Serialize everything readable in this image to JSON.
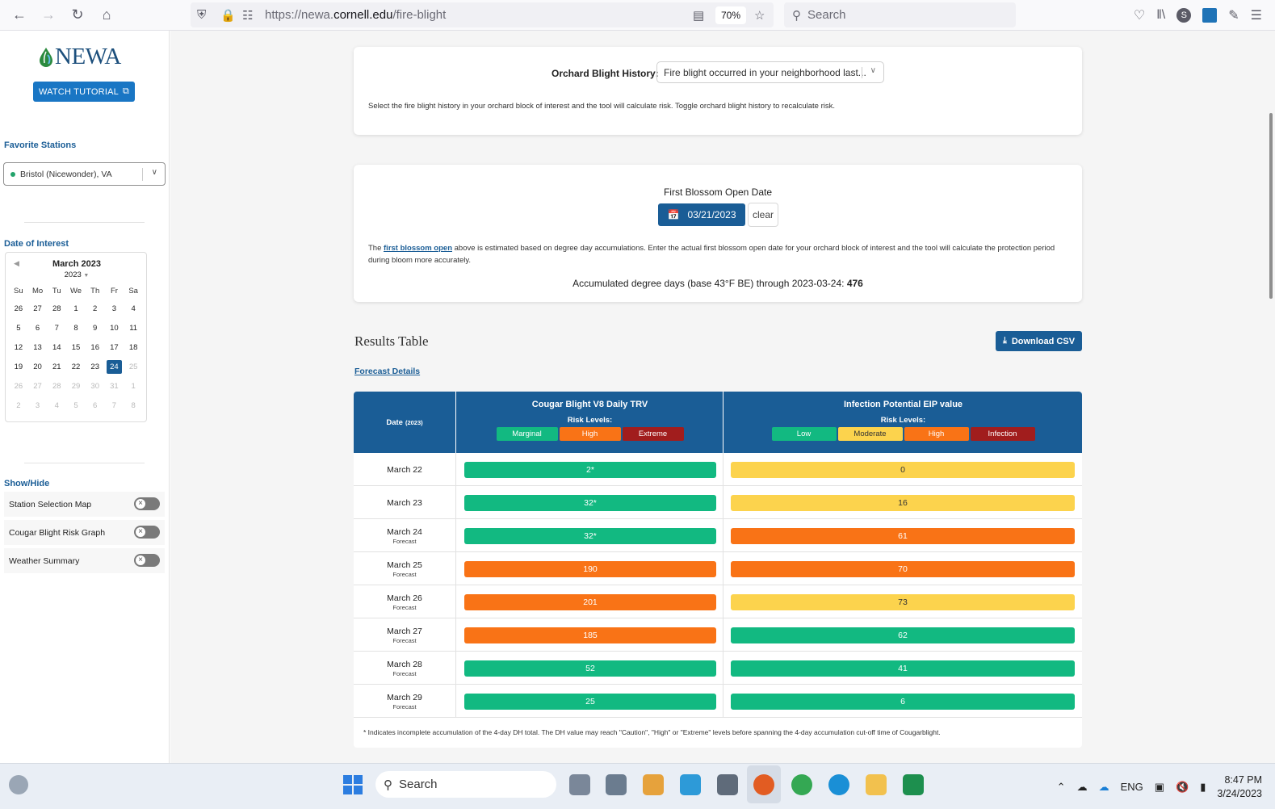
{
  "browser": {
    "url_prefix": "https://newa.",
    "url_host": "cornell.edu",
    "url_path": "/fire-blight",
    "zoom": "70%",
    "search_placeholder": "Search",
    "profile_initial": "S"
  },
  "sidebar": {
    "logo_text": "NEWA",
    "tutorial_label": "WATCH TUTORIAL",
    "favorite_stations_heading": "Favorite Stations",
    "station_name": "Bristol (Nicewonder),",
    "station_state": "VA",
    "date_of_interest_heading": "Date of Interest",
    "calendar": {
      "month_label": "March 2023",
      "year_label": "2023",
      "weekdays": [
        "Su",
        "Mo",
        "Tu",
        "We",
        "Th",
        "Fr",
        "Sa"
      ],
      "weeks": [
        [
          {
            "d": "26",
            "m": false
          },
          {
            "d": "27",
            "m": false
          },
          {
            "d": "28",
            "m": false
          },
          {
            "d": "1",
            "m": false
          },
          {
            "d": "2",
            "m": false
          },
          {
            "d": "3",
            "m": false
          },
          {
            "d": "4",
            "m": false
          }
        ],
        [
          {
            "d": "5",
            "m": false
          },
          {
            "d": "6",
            "m": false
          },
          {
            "d": "7",
            "m": false
          },
          {
            "d": "8",
            "m": false
          },
          {
            "d": "9",
            "m": false
          },
          {
            "d": "10",
            "m": false
          },
          {
            "d": "11",
            "m": false
          }
        ],
        [
          {
            "d": "12",
            "m": false
          },
          {
            "d": "13",
            "m": false
          },
          {
            "d": "14",
            "m": false
          },
          {
            "d": "15",
            "m": false
          },
          {
            "d": "16",
            "m": false
          },
          {
            "d": "17",
            "m": false
          },
          {
            "d": "18",
            "m": false
          }
        ],
        [
          {
            "d": "19",
            "m": false
          },
          {
            "d": "20",
            "m": false
          },
          {
            "d": "21",
            "m": false
          },
          {
            "d": "22",
            "m": false
          },
          {
            "d": "23",
            "m": false
          },
          {
            "d": "24",
            "m": false,
            "sel": true
          },
          {
            "d": "25",
            "m": true
          }
        ],
        [
          {
            "d": "26",
            "m": true
          },
          {
            "d": "27",
            "m": true
          },
          {
            "d": "28",
            "m": true
          },
          {
            "d": "29",
            "m": true
          },
          {
            "d": "30",
            "m": true
          },
          {
            "d": "31",
            "m": true
          },
          {
            "d": "1",
            "m": true
          }
        ],
        [
          {
            "d": "2",
            "m": true
          },
          {
            "d": "3",
            "m": true
          },
          {
            "d": "4",
            "m": true
          },
          {
            "d": "5",
            "m": true
          },
          {
            "d": "6",
            "m": true
          },
          {
            "d": "7",
            "m": true
          },
          {
            "d": "8",
            "m": true
          }
        ]
      ]
    },
    "show_hide_heading": "Show/Hide",
    "toggles": [
      {
        "label": "Station Selection Map",
        "on": false
      },
      {
        "label": "Cougar Blight Risk Graph",
        "on": false
      },
      {
        "label": "Weather Summary",
        "on": false
      }
    ]
  },
  "history": {
    "label": "Orchard Blight History:",
    "selected": "Fire blight occurred in your neighborhood last...",
    "description": "Select the fire blight history in your orchard block of interest and the tool will calculate risk. Toggle orchard blight history to recalculate risk."
  },
  "blossom": {
    "title": "First Blossom Open Date",
    "date": "03/21/2023",
    "clear_label": "clear",
    "desc_before": "The",
    "desc_link": "first blossom open",
    "desc_after": "above is estimated based on degree day accumulations. Enter the actual first blossom open date for your orchard block of interest and the tool will calculate the protection period during bloom more accurately.",
    "accum_text": "Accumulated degree days (base 43°F BE) through 2023-03-24:",
    "accum_value": "476"
  },
  "results": {
    "title": "Results Table",
    "csv_label": "Download CSV",
    "forecast_link": "Forecast Details",
    "date_header": "Date",
    "date_year": "(2023)",
    "cougar_header": "Cougar Blight V8 Daily TRV",
    "eip_header": "Infection Potential EIP value",
    "risk_levels_label": "Risk Levels:",
    "cougar_levels": [
      {
        "label": "Marginal",
        "bg": "#12b981",
        "fg": "#ffffff",
        "w": 76
      },
      {
        "label": "High",
        "bg": "#f97316",
        "fg": "#ffffff",
        "w": 76
      },
      {
        "label": "Extreme",
        "bg": "#a11d1d",
        "fg": "#ffffff",
        "w": 76
      }
    ],
    "eip_levels": [
      {
        "label": "Low",
        "bg": "#12b981",
        "fg": "#ffffff",
        "w": 80
      },
      {
        "label": "Moderate",
        "bg": "#fcd34d",
        "fg": "#333333",
        "w": 80
      },
      {
        "label": "High",
        "bg": "#f97316",
        "fg": "#ffffff",
        "w": 80
      },
      {
        "label": "Infection",
        "bg": "#a11d1d",
        "fg": "#ffffff",
        "w": 80
      }
    ],
    "rows": [
      {
        "date": "March 22",
        "forecast": "",
        "trv": "2*",
        "trv_color": "#12b981",
        "trv_fg": "#ffffff",
        "eip": "0",
        "eip_color": "#fcd34d",
        "eip_fg": "#333333"
      },
      {
        "date": "March 23",
        "forecast": "",
        "trv": "32*",
        "trv_color": "#12b981",
        "trv_fg": "#ffffff",
        "eip": "16",
        "eip_color": "#fcd34d",
        "eip_fg": "#333333"
      },
      {
        "date": "March 24",
        "forecast": "Forecast",
        "trv": "32*",
        "trv_color": "#12b981",
        "trv_fg": "#ffffff",
        "eip": "61",
        "eip_color": "#f97316",
        "eip_fg": "#ffffff"
      },
      {
        "date": "March 25",
        "forecast": "Forecast",
        "trv": "190",
        "trv_color": "#f97316",
        "trv_fg": "#ffffff",
        "eip": "70",
        "eip_color": "#f97316",
        "eip_fg": "#ffffff"
      },
      {
        "date": "March 26",
        "forecast": "Forecast",
        "trv": "201",
        "trv_color": "#f97316",
        "trv_fg": "#ffffff",
        "eip": "73",
        "eip_color": "#fcd34d",
        "eip_fg": "#333333"
      },
      {
        "date": "March 27",
        "forecast": "Forecast",
        "trv": "185",
        "trv_color": "#f97316",
        "trv_fg": "#ffffff",
        "eip": "62",
        "eip_color": "#12b981",
        "eip_fg": "#ffffff"
      },
      {
        "date": "March 28",
        "forecast": "Forecast",
        "trv": "52",
        "trv_color": "#12b981",
        "trv_fg": "#ffffff",
        "eip": "41",
        "eip_color": "#12b981",
        "eip_fg": "#ffffff"
      },
      {
        "date": "March 29",
        "forecast": "Forecast",
        "trv": "25",
        "trv_color": "#12b981",
        "trv_fg": "#ffffff",
        "eip": "6",
        "eip_color": "#12b981",
        "eip_fg": "#ffffff"
      }
    ],
    "footnote": "* Indicates incomplete accumulation of the 4-day DH total. The DH value may reach \"Caution\", \"High\" or \"Extreme\" levels before spanning the 4-day accumulation cut-off time of Cougarblight."
  },
  "taskbar": {
    "search_label": "Search",
    "lang": "ENG",
    "time": "8:47 PM",
    "date": "3/24/2023"
  }
}
